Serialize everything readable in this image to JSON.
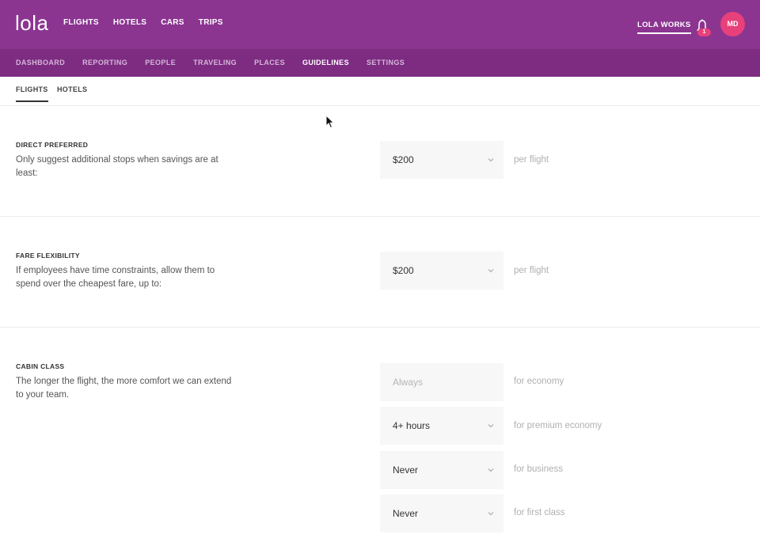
{
  "header": {
    "logo": "lola",
    "nav": [
      "FLIGHTS",
      "HOTELS",
      "CARS",
      "TRIPS"
    ],
    "company": "LOLA WORKS",
    "notification_count": "1",
    "avatar_initials": "MD",
    "brand_color": "#8b3591",
    "badge_color": "#e8407a"
  },
  "subnav": {
    "items": [
      "DASHBOARD",
      "REPORTING",
      "PEOPLE",
      "TRAVELING",
      "PLACES",
      "GUIDELINES",
      "SETTINGS"
    ],
    "active": "GUIDELINES"
  },
  "tabs": {
    "items": [
      "FLIGHTS",
      "HOTELS"
    ],
    "active": "FLIGHTS"
  },
  "sections": {
    "direct": {
      "title": "DIRECT PREFERRED",
      "desc_line1": "Only suggest additional stops when savings are at",
      "desc_line2": "least:",
      "value": "$200",
      "suffix": "per flight"
    },
    "fare": {
      "title": "FARE FLEXIBILITY",
      "desc_line1": "If employees have time constraints, allow them to",
      "desc_line2": "spend over the cheapest fare, up to:",
      "value": "$200",
      "suffix": "per flight"
    },
    "cabin": {
      "title": "CABIN CLASS",
      "desc_line1": "The longer the flight, the more comfort we can extend",
      "desc_line2": "to your team.",
      "rows": [
        {
          "value": "Always",
          "suffix": "for economy"
        },
        {
          "value": "4+ hours",
          "suffix": "for premium economy"
        },
        {
          "value": "Never",
          "suffix": "for business"
        },
        {
          "value": "Never",
          "suffix": "for first class"
        }
      ]
    }
  }
}
